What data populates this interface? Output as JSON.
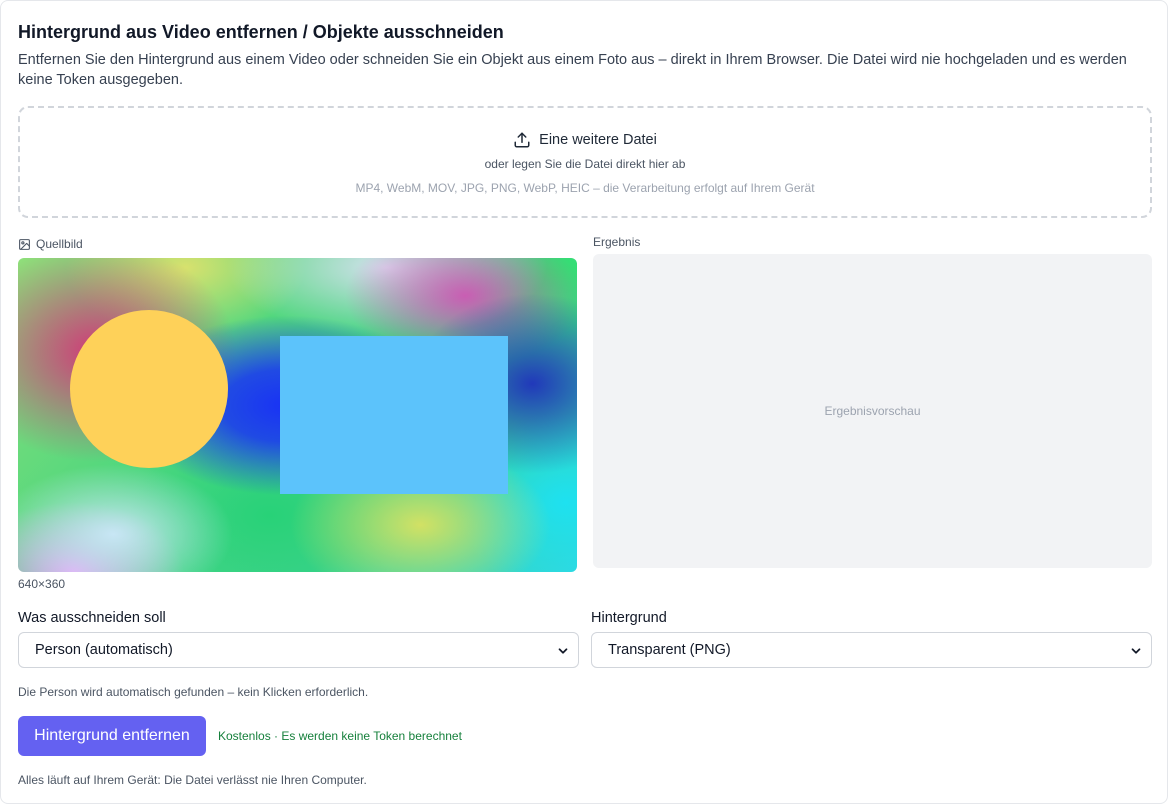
{
  "header": {
    "title": "Hintergrund aus Video entfernen / Objekte ausschneiden",
    "description": "Entfernen Sie den Hintergrund aus einem Video oder schneiden Sie ein Objekt aus einem Foto aus – direkt in Ihrem Browser. Die Datei wird nie hochgeladen und es werden keine Token ausgegeben."
  },
  "dropzone": {
    "button_label": "Eine weitere Datei",
    "icon": "upload-icon",
    "subtext": "oder legen Sie die Datei direkt hier ab",
    "formats": "MP4, WebM, MOV, JPG, PNG, WebP, HEIC – die Verarbeitung erfolgt auf Ihrem Gerät"
  },
  "source": {
    "label": "Quellbild",
    "icon": "image-icon",
    "dimensions": "640×360",
    "colors": {
      "circle": "#fed159",
      "rectangle": "#5cc3fb"
    }
  },
  "result": {
    "label": "Ergebnis",
    "placeholder": "Ergebnisvorschau"
  },
  "controls": {
    "cut_label": "Was ausschneiden soll",
    "cut_value": "Person (automatisch)",
    "background_label": "Hintergrund",
    "background_value": "Transparent (PNG)",
    "hint": "Die Person wird automatisch gefunden – kein Klicken erforderlich."
  },
  "action": {
    "button_label": "Hintergrund entfernen",
    "free_note": "Kostenlos · Es werden keine Token berechnet",
    "footer": "Alles läuft auf Ihrem Gerät: Die Datei verlässt nie Ihren Computer."
  },
  "colors": {
    "accent": "#6461f1",
    "success_text": "#16803c",
    "result_bg": "#f2f3f5"
  }
}
